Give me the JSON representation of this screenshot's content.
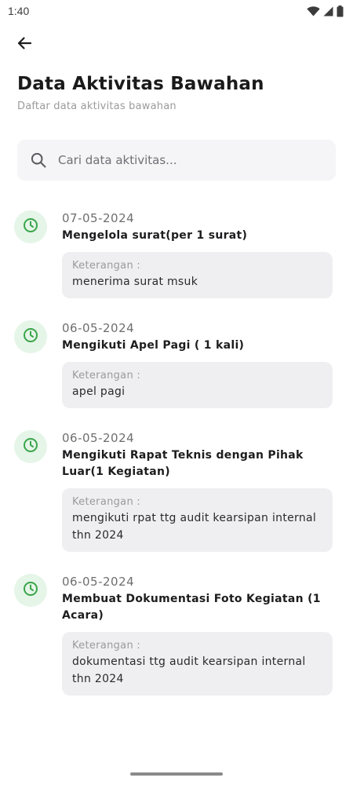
{
  "status_bar": {
    "time": "1:40"
  },
  "header": {
    "title": "Data Aktivitas Bawahan",
    "subtitle": "Daftar data aktivitas bawahan"
  },
  "search": {
    "placeholder": "Cari data aktivitas..."
  },
  "colors": {
    "accent_green": "#3aa54a",
    "icon_bg": "#e5f5e8",
    "note_bg": "#efeef1"
  },
  "activities": [
    {
      "date": "07-05-2024",
      "title": "Mengelola surat(per 1 surat)",
      "note_label": "Keterangan :",
      "note": "menerima surat msuk",
      "icon": "clock-icon"
    },
    {
      "date": "06-05-2024",
      "title": "Mengikuti Apel Pagi ( 1 kali)",
      "note_label": "Keterangan :",
      "note": "apel pagi",
      "icon": "clock-icon"
    },
    {
      "date": "06-05-2024",
      "title": "Mengikuti Rapat Teknis dengan Pihak Luar(1 Kegiatan)",
      "note_label": "Keterangan :",
      "note": "mengikuti rpat ttg audit kearsipan internal thn 2024",
      "icon": "clock-icon"
    },
    {
      "date": "06-05-2024",
      "title": "Membuat Dokumentasi Foto Kegiatan (1 Acara)",
      "note_label": "Keterangan :",
      "note": "dokumentasi ttg audit kearsipan internal thn 2024",
      "icon": "clock-icon"
    }
  ]
}
